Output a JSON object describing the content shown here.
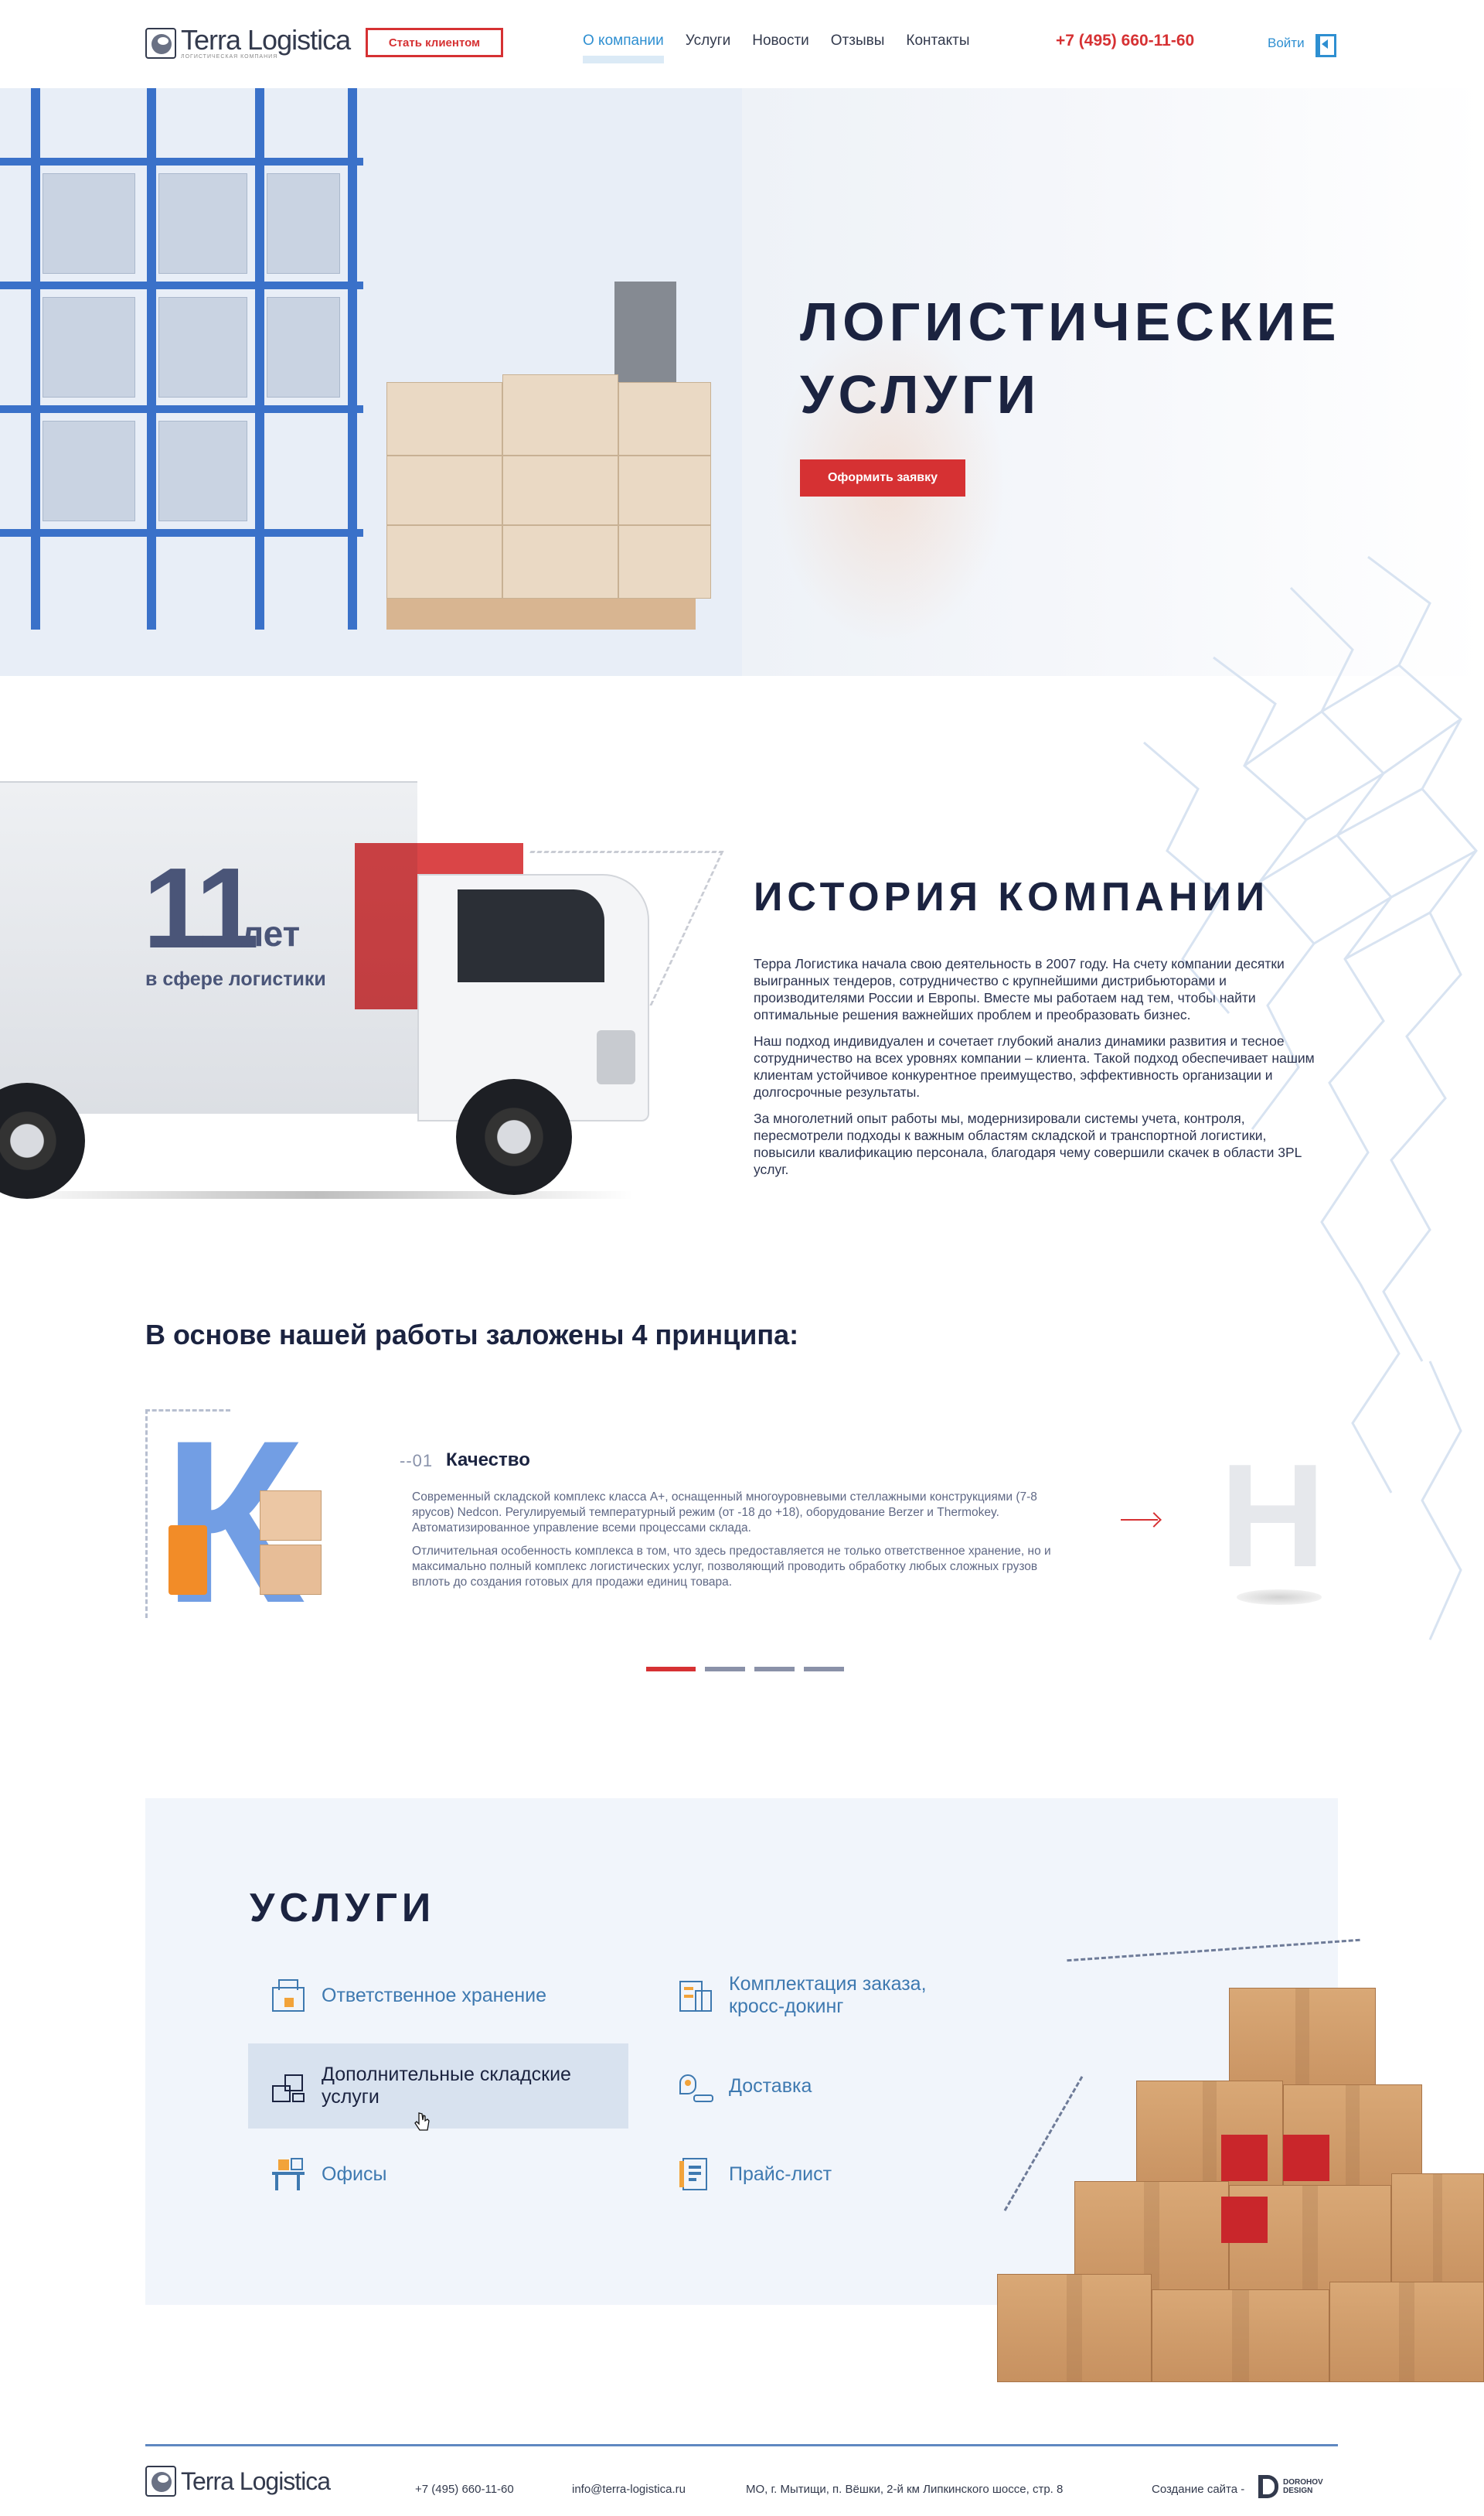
{
  "header": {
    "logo_name": "Terra Logistica",
    "logo_sub": "ЛОГИСТИЧЕСКАЯ КОМПАНИЯ",
    "become_client": "Стать клиентом",
    "nav": [
      "О компании",
      "Услуги",
      "Новости",
      "Отзывы",
      "Контакты"
    ],
    "phone": "+7 (495) 660-11-60",
    "login": "Войти"
  },
  "hero": {
    "title_line1": "ЛОГИСТИЧЕСКИЕ",
    "title_line2": "УСЛУГИ",
    "cta": "Оформить заявку"
  },
  "history": {
    "years_number": "11",
    "years_unit": "лет",
    "years_caption": "в сфере логистики",
    "title": "ИСТОРИЯ КОМПАНИИ",
    "paragraphs": [
      "Терра Логистика начала свою деятельность в 2007 году. На счету компании десятки выигранных тендеров, сотрудничество с крупнейшими дистрибьюторами и производителями России и Европы. Вместе мы работаем над тем, чтобы найти оптимальные решения важнейших проблем и преобразовать бизнес.",
      "Наш подход индивидуален и сочетает глубокий анализ динамики развития и тесное сотрудничество на всех уровнях компании – клиента. Такой подход обеспечивает нашим клиентам устойчивое конкурентное преимущество, эффективность организации и долгосрочные результаты.",
      "За многолетний опыт работы мы, модернизировали системы учета, контроля, пересмотрели подходы к важным областям складской и транспортной логистики, повысили квалификацию персонала, благодаря чему совершили скачек в области 3PL услуг."
    ]
  },
  "principles": {
    "title": "В основе нашей работы заложены 4 принципа:",
    "current": {
      "letter": "К",
      "number": "01",
      "name": "Качество",
      "paragraphs": [
        "Современный складской комплекс класса А+, оснащенный многоуровневыми стеллажными конструкциями (7-8 ярусов) Nedcon. Регулируемый температурный режим (от -18 до +18), оборудование Berzer и Thermokey. Автоматизированное управление всеми процессами склада.",
        "Отличительная особенность комплекса в том, что здесь предоставляется не только ответственное хранение, но и максимально полный комплекс логистических услуг, позволяющий проводить обработку любых сложных грузов вплоть до создания готовых для продажи единиц товара."
      ]
    },
    "next_letter": "Н",
    "slides_total": 4,
    "slide_active": 1
  },
  "services": {
    "title": "УСЛУГИ",
    "items": [
      {
        "label": "Ответственное хранение",
        "icon": "warehouse-icon"
      },
      {
        "label": "Комплектация заказа, кросс-докинг",
        "icon": "order-picking-icon"
      },
      {
        "label": "Дополнительные складские услуги",
        "icon": "storage-services-icon"
      },
      {
        "label": "Доставка",
        "icon": "delivery-icon"
      },
      {
        "label": "Офисы",
        "icon": "office-icon"
      },
      {
        "label": "Прайс-лист",
        "icon": "price-list-icon"
      }
    ]
  },
  "footer": {
    "logo_name": "Terra Logistica",
    "phone": "+7 (495) 660-11-60",
    "email": "info@terra-logistica.ru",
    "address": "МО, г. Мытищи, п. Вёшки, 2-й км Липкинского шоссе, стр. 8",
    "credit": "Создание сайта -",
    "designer_line1": "DOROHOV",
    "designer_line2": "DESIGN"
  },
  "colors": {
    "accent_red": "#d63133",
    "accent_blue": "#2e8fd1",
    "dark_navy": "#1b2340",
    "services_bg": "#f1f5fb"
  }
}
